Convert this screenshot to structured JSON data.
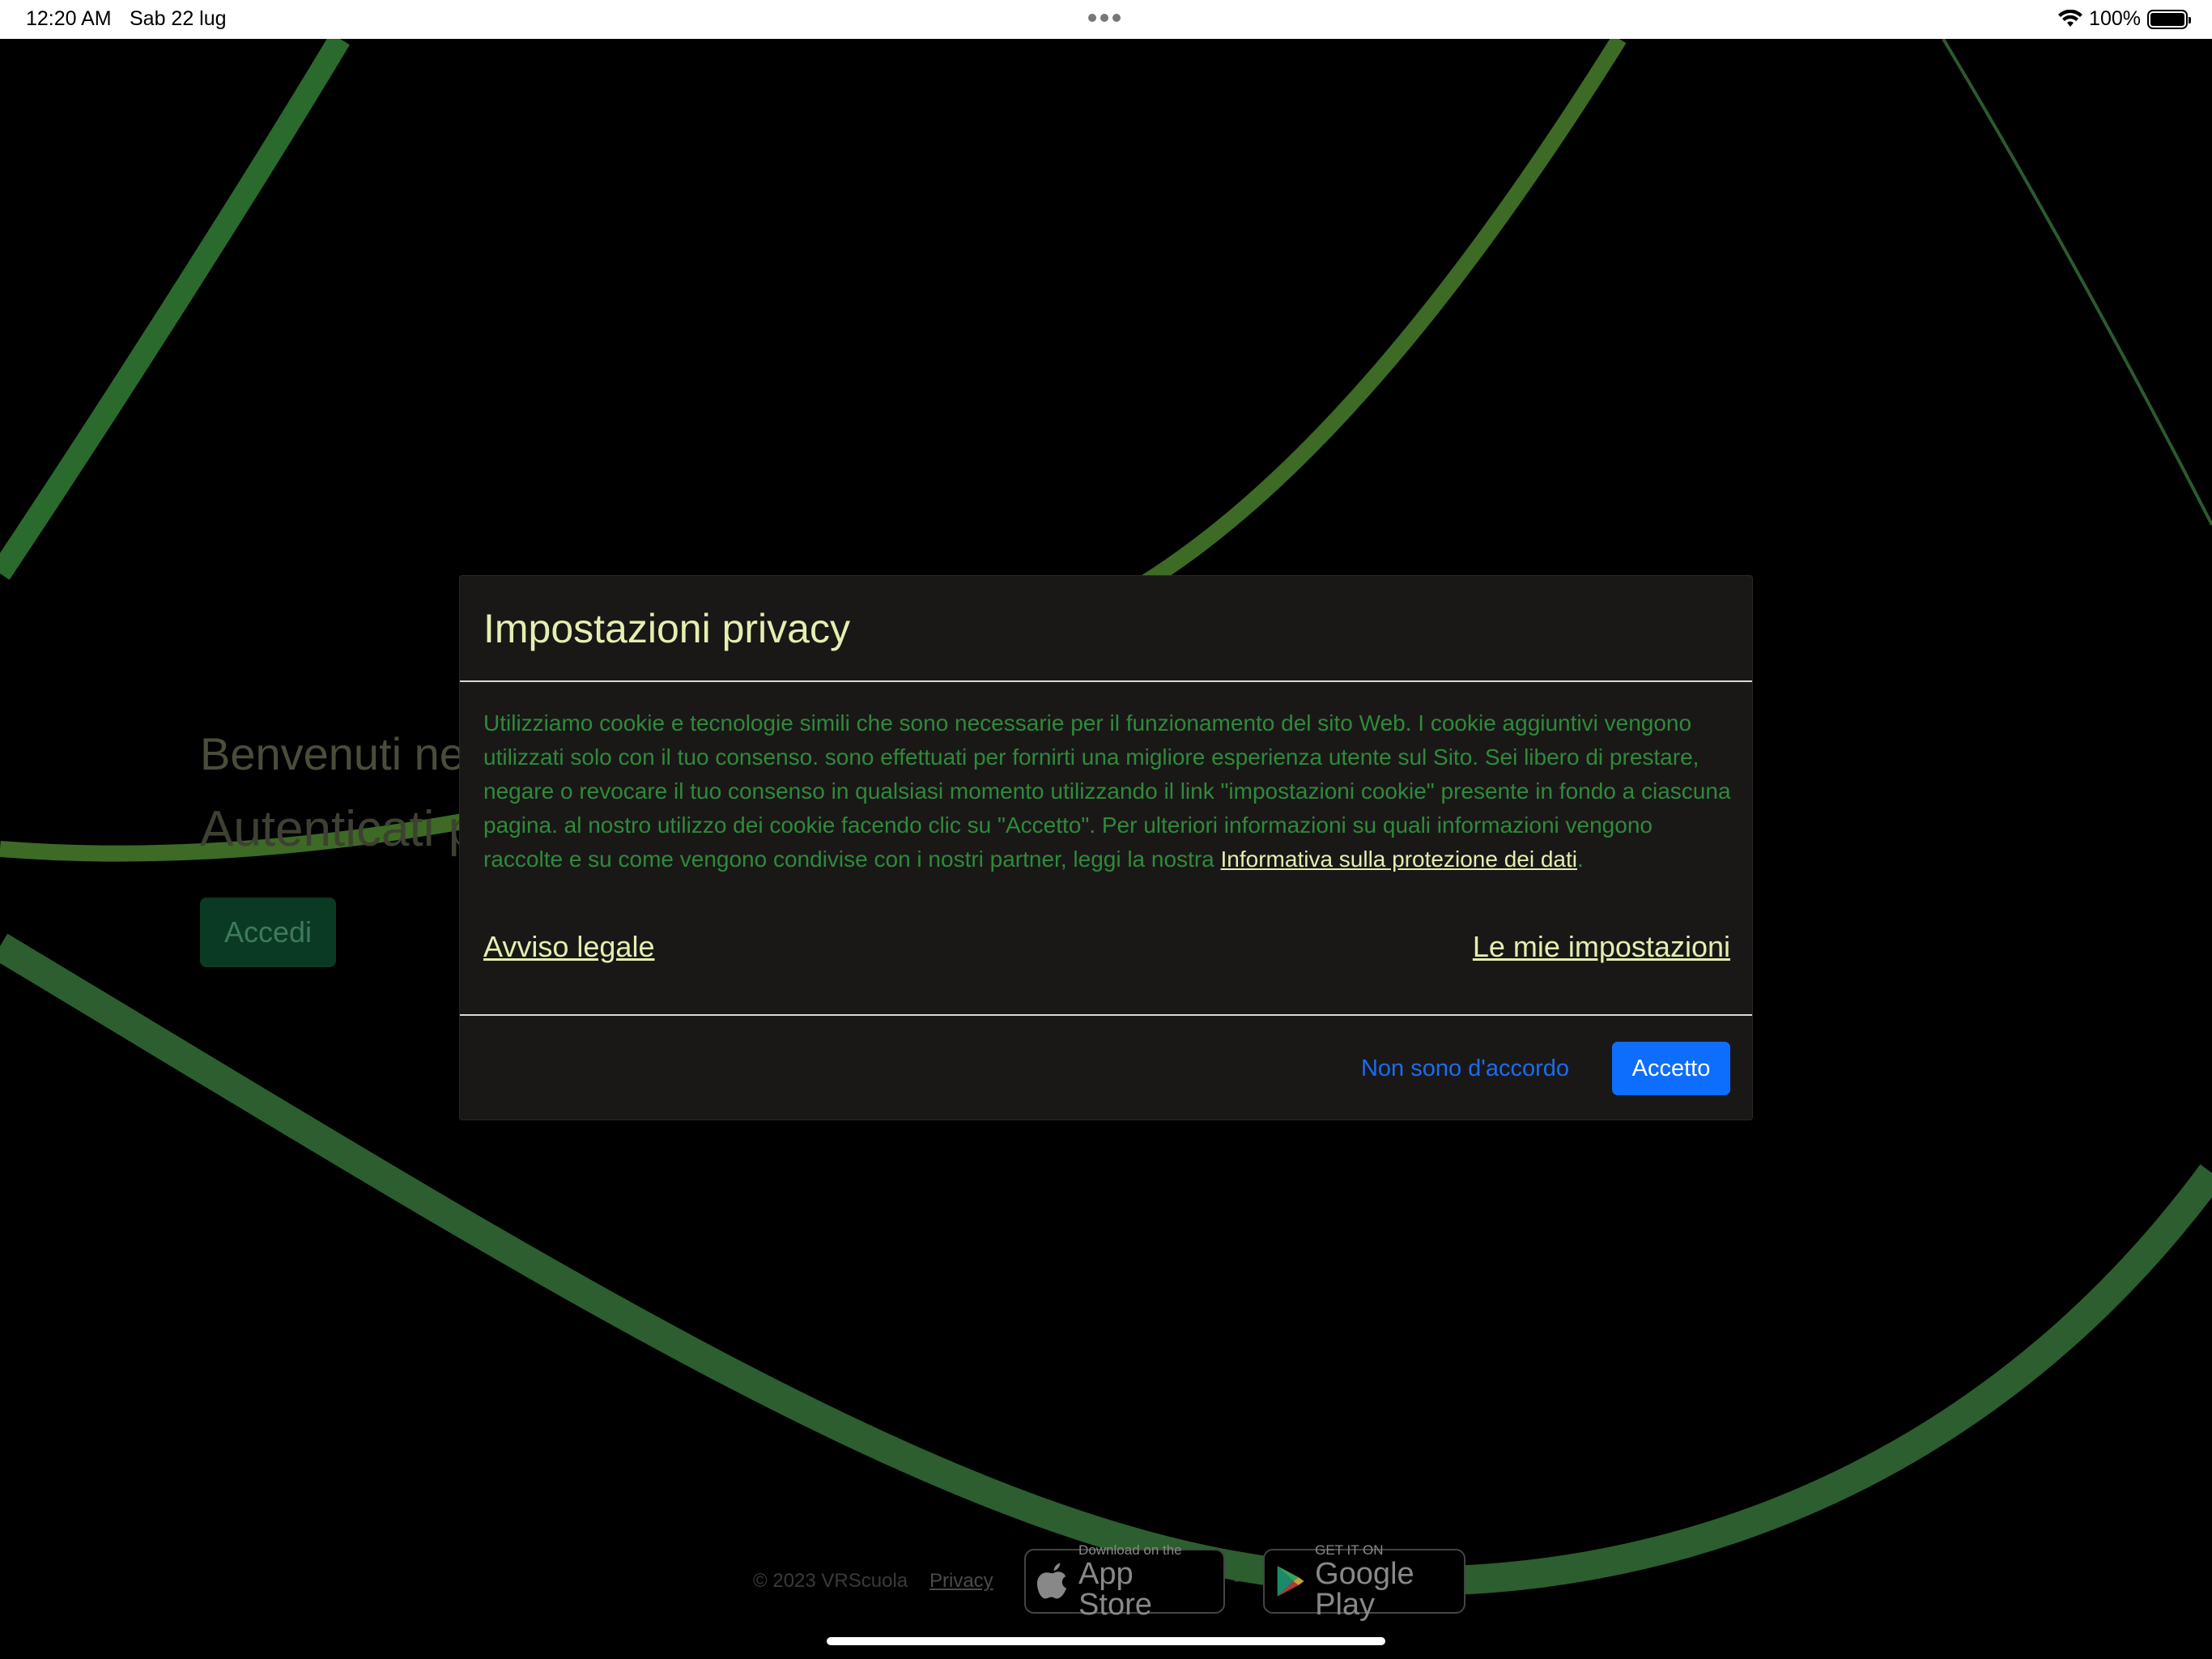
{
  "status_bar": {
    "time": "12:20 AM",
    "date": "Sab 22 lug",
    "battery": "100%",
    "battery_level": 1.0
  },
  "background": {
    "welcome_title": "Benvenuti ne",
    "welcome_subtitle": "Autenticati p",
    "login_button": "Accedi"
  },
  "footer": {
    "copyright": "© 2023 VRScuola",
    "privacy": "Privacy",
    "separator": "-",
    "app_store_small": "Download on the",
    "app_store_big": "App Store",
    "google_play_small": "GET IT ON",
    "google_play_big": "Google Play"
  },
  "modal": {
    "title": "Impostazioni privacy",
    "body_text": "Utilizziamo cookie e tecnologie simili che sono necessarie per il funzionamento del sito Web. I cookie aggiuntivi vengono utilizzati solo con il tuo consenso. sono effettuati per fornirti una migliore esperienza utente sul Sito. Sei libero di prestare, negare o revocare il tuo consenso in qualsiasi momento utilizzando il link \"impostazioni cookie\" presente in fondo a ciascuna pagina. al nostro utilizzo dei cookie facendo clic su \"Accetto\". Per ulteriori informazioni su quali informazioni vengono raccolte e su come vengono condivise con i nostri partner, leggi la nostra ",
    "policy_link": "Informativa sulla protezione dei dati",
    "body_end": ".",
    "legal_link": "Avviso legale",
    "settings_link": "Le mie impostazioni",
    "decline_button": "Non sono d'accordo",
    "accept_button": "Accetto"
  },
  "colors": {
    "modal_background": "#1a1817",
    "title": "#e4efb0",
    "body_text": "#2f8a3a",
    "accent": "#0d6efd",
    "curve_green": "#2e6b2f"
  }
}
